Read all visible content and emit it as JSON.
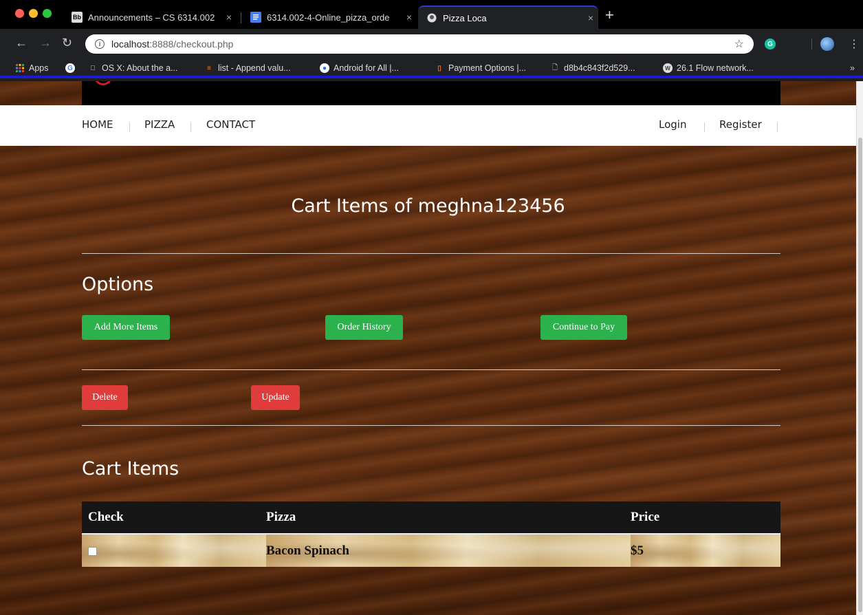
{
  "browser": {
    "tabs": [
      {
        "label": "Announcements – CS 6314.002",
        "favicon": "Bb"
      },
      {
        "label": "6314.002-4-Online_pizza_orde",
        "favicon": "docs-icon"
      },
      {
        "label": "Pizza Loca",
        "favicon": "site-icon"
      }
    ],
    "new_tab": "+",
    "close_glyph": "×",
    "url_host": "localhost",
    "url_rest": ":8888/checkout.php",
    "bookmarks": [
      {
        "label": "Apps"
      },
      {
        "label": ""
      },
      {
        "label": "OS X: About the a..."
      },
      {
        "label": "list - Append valu..."
      },
      {
        "label": "Android for All |..."
      },
      {
        "label": "Payment Options |..."
      },
      {
        "label": "d8b4c843f2d529..."
      },
      {
        "label": "26.1 Flow network..."
      }
    ],
    "bookmarks_more": "»"
  },
  "nav": {
    "left": [
      "HOME",
      "PIZZA",
      "CONTACT"
    ],
    "right": [
      "Login",
      "Register"
    ]
  },
  "page": {
    "title": "Cart Items of meghna123456",
    "options_heading": "Options",
    "buttons": {
      "add_more": "Add More Items",
      "order_history": "Order History",
      "continue_pay": "Continue to Pay",
      "delete": "Delete",
      "update": "Update"
    },
    "cart_heading": "Cart Items",
    "table": {
      "headers": [
        "Check",
        "Pizza",
        "Price"
      ],
      "rows": [
        {
          "checked": false,
          "pizza": "Bacon Spinach",
          "price": "$5"
        }
      ]
    }
  },
  "colors": {
    "accent_green": "#2bb24c",
    "accent_red": "#e03c3c",
    "tab_highlight": "#2a3bd8"
  }
}
